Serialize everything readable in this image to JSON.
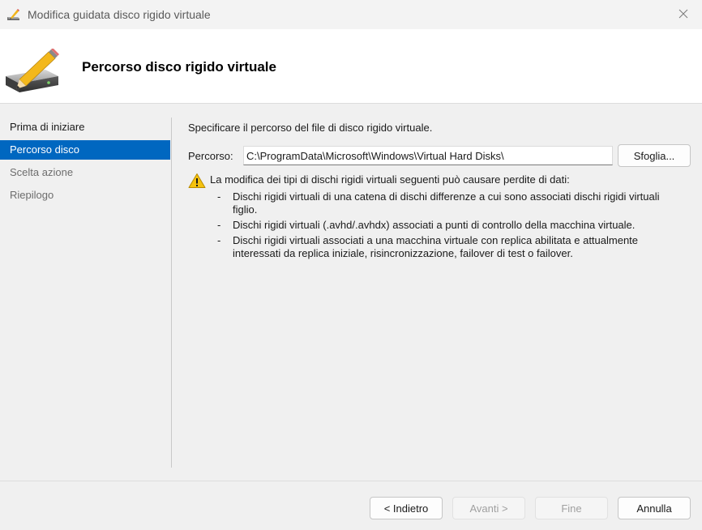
{
  "window": {
    "title": "Modifica guidata disco rigido virtuale",
    "app_icon": "wizard-disk-pencil-icon",
    "close_icon": "close-icon"
  },
  "header": {
    "title": "Percorso disco rigido virtuale",
    "icon": "hard-disk-pencil-icon"
  },
  "nav": {
    "items": [
      {
        "label": "Prima di iniziare",
        "state": "normal"
      },
      {
        "label": "Percorso disco",
        "state": "selected"
      },
      {
        "label": "Scelta azione",
        "state": "disabled"
      },
      {
        "label": "Riepilogo",
        "state": "disabled"
      }
    ]
  },
  "content": {
    "intro": "Specificare il percorso del file di disco rigido virtuale.",
    "path_label": "Percorso:",
    "path_value": "C:\\ProgramData\\Microsoft\\Windows\\Virtual Hard Disks\\",
    "browse_label": "Sfoglia...",
    "warning": {
      "icon": "warning-icon",
      "text": "La modifica dei tipi di dischi rigidi virtuali seguenti può causare perdite di dati:",
      "items": [
        "Dischi rigidi virtuali di una catena di dischi differenze a cui sono associati dischi rigidi virtuali figlio.",
        "Dischi rigidi virtuali (.avhd/.avhdx) associati a punti di controllo della macchina virtuale.",
        "Dischi rigidi virtuali associati a una macchina virtuale con replica abilitata e attualmente interessati da replica iniziale, risincronizzazione, failover di test o failover."
      ]
    }
  },
  "footer": {
    "back_label": "< Indietro",
    "next_label": "Avanti >",
    "finish_label": "Fine",
    "cancel_label": "Annulla"
  },
  "colors": {
    "accent": "#0067c0",
    "warning_yellow": "#f5c20f"
  }
}
